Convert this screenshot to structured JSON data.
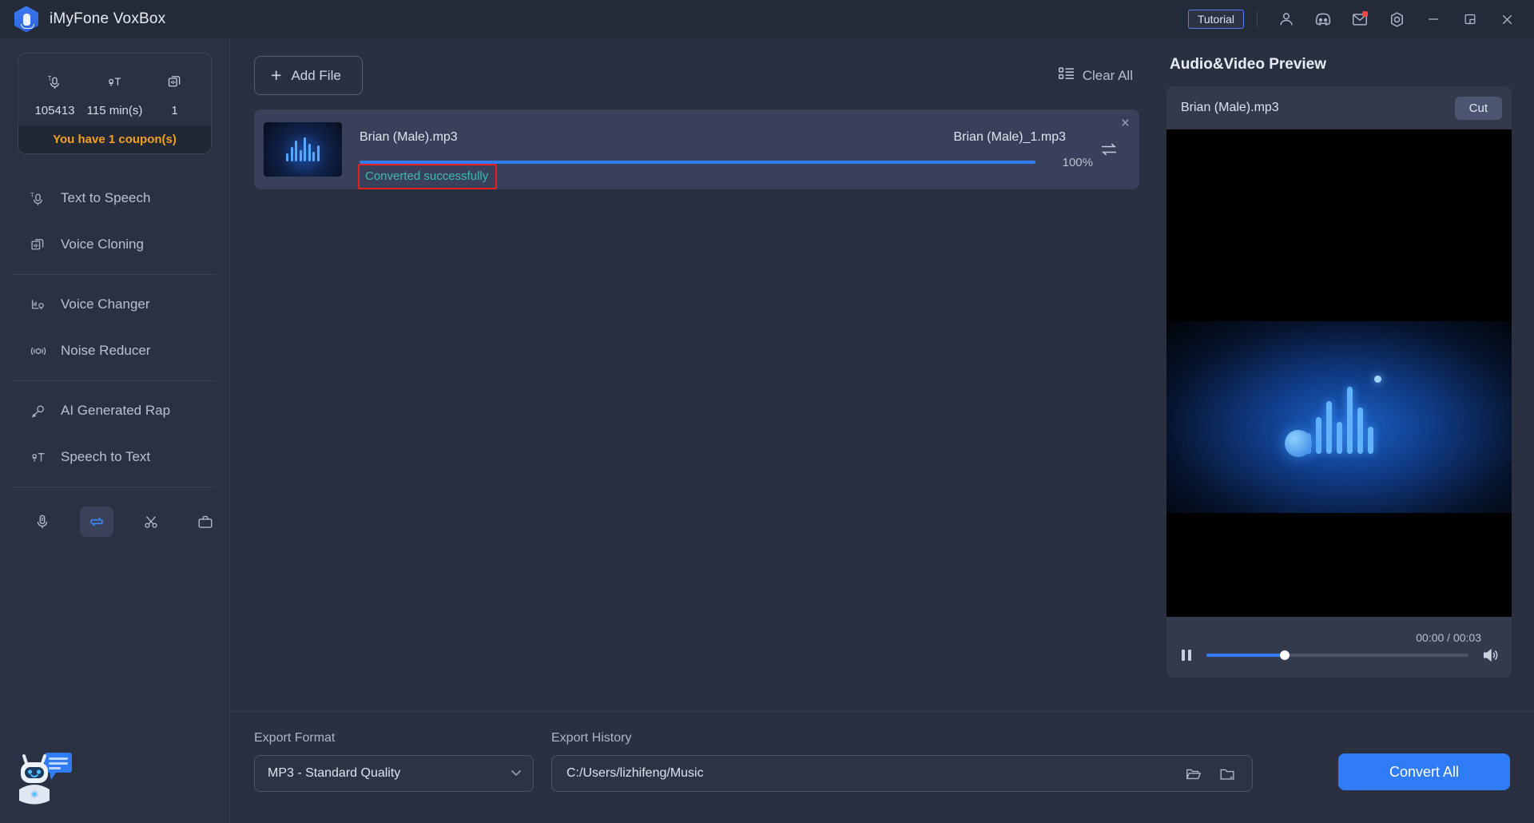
{
  "titlebar": {
    "app_title": "iMyFone VoxBox",
    "logo_icon": "voxbox-hex-mic-logo",
    "tutorial_label": "Tutorial",
    "icons": [
      {
        "name": "account-icon",
        "glyph": "person"
      },
      {
        "name": "discord-icon",
        "glyph": "discord"
      },
      {
        "name": "mail-icon",
        "glyph": "envelope",
        "badge": true
      },
      {
        "name": "settings-icon",
        "glyph": "gear"
      }
    ],
    "window_controls": [
      {
        "name": "minimize-button",
        "glyph": "—"
      },
      {
        "name": "maximize-button",
        "glyph": "restore"
      },
      {
        "name": "close-button",
        "glyph": "×"
      }
    ]
  },
  "sidebar": {
    "credits": [
      {
        "icon": "text-to-speech-credit-icon",
        "value": "105413"
      },
      {
        "icon": "speech-to-text-credit-icon",
        "value": "115 min(s)"
      },
      {
        "icon": "voice-cloning-credit-icon",
        "value": "1"
      }
    ],
    "coupon_text": "You have 1 coupon(s)",
    "items": [
      {
        "label": "Text to Speech",
        "icon": "text-to-speech-icon"
      },
      {
        "label": "Voice Cloning",
        "icon": "voice-cloning-icon"
      },
      {
        "label": "Voice Changer",
        "icon": "voice-changer-icon"
      },
      {
        "label": "Noise Reducer",
        "icon": "noise-reducer-icon"
      },
      {
        "label": "AI Generated Rap",
        "icon": "ai-generated-rap-icon"
      },
      {
        "label": "Speech to Text",
        "icon": "speech-to-text-icon"
      }
    ],
    "tools": [
      {
        "name": "recorder-tool-icon",
        "active": false
      },
      {
        "name": "converter-tool-icon",
        "active": true
      },
      {
        "name": "cutter-tool-icon",
        "active": false
      },
      {
        "name": "toolbox-tool-icon",
        "active": false
      }
    ],
    "chatbot_icon": "chatbot-assistant-icon"
  },
  "toolbar": {
    "add_file_label": "Add File",
    "add_file_icon": "plus-icon",
    "clear_all_label": "Clear All",
    "clear_all_icon": "list-icon"
  },
  "files": [
    {
      "source_name": "Brian (Male).mp3",
      "output_name": "Brian (Male)_1.mp3",
      "progress_pct": 100,
      "progress_label": "100%",
      "status": "Converted successfully",
      "status_color": "#3fb9b0",
      "highlight_color": "#e8201f",
      "thumb_icon": "audio-waveform-thumbnail",
      "swap_icon": "swap-arrows-icon",
      "close_icon": "close-icon"
    }
  ],
  "preview": {
    "title": "Audio&Video Preview",
    "file_name": "Brian (Male).mp3",
    "cut_label": "Cut",
    "artwork_icon": "audio-visualizer-artwork",
    "time_display": "00:00 / 00:03",
    "current_time": "00:00",
    "total_time": "00:03",
    "seek_pct": 30,
    "play_icon": "pause-icon",
    "volume_icon": "volume-icon"
  },
  "export": {
    "format_label": "Export Format",
    "format_value": "MP3 - Standard Quality",
    "format_chevron": "chevron-down-icon",
    "history_label": "Export History",
    "history_path": "C:/Users/lizhifeng/Music",
    "open_folder_icon": "open-folder-icon",
    "folder_icon": "folder-icon",
    "convert_all_label": "Convert All",
    "accent_color": "#2f7cf6"
  }
}
